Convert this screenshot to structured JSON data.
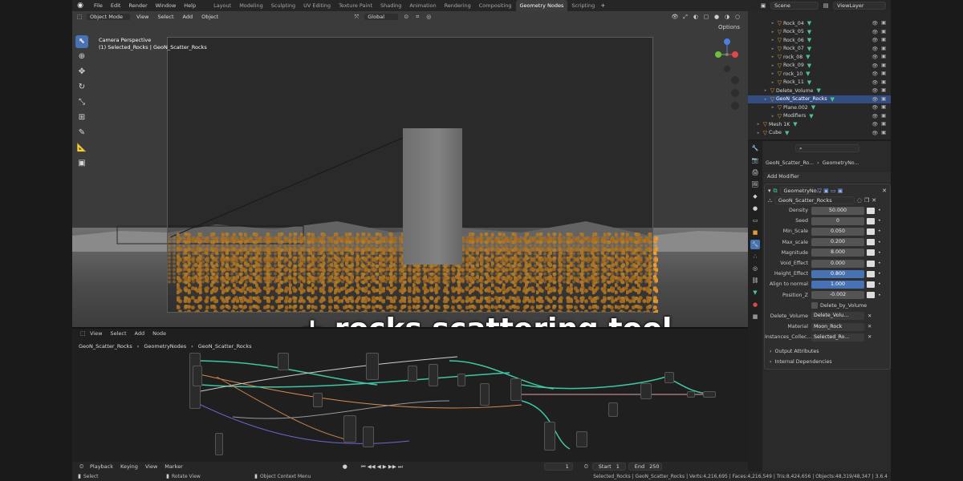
{
  "menu": [
    "File",
    "Edit",
    "Render",
    "Window",
    "Help"
  ],
  "workspaces": [
    "Layout",
    "Modeling",
    "Sculpting",
    "UV Editing",
    "Texture Paint",
    "Shading",
    "Animation",
    "Rendering",
    "Compositing",
    "Geometry Nodes",
    "Scripting"
  ],
  "active_workspace": "Geometry Nodes",
  "scene": "Scene",
  "view_layer": "ViewLayer",
  "viewport": {
    "mode": "Object Mode",
    "menus": [
      "View",
      "Select",
      "Add",
      "Object"
    ],
    "orientation": "Global",
    "options_label": "Options",
    "info_line1": "Camera Perspective",
    "info_line2": "(1) Selected_Rocks | GeoN_Scatter_Rocks"
  },
  "caption": "+ rocks scattering tool",
  "node_editor": {
    "menus": [
      "View",
      "Select",
      "Add",
      "Node"
    ],
    "breadcrumb": [
      "GeoN_Scatter_Rocks",
      "GeometryNodes",
      "GeoN_Scatter_Rocks"
    ]
  },
  "outliner": [
    {
      "name": "Rock_04",
      "indent": 3,
      "sel": false
    },
    {
      "name": "Rock_05",
      "indent": 3,
      "sel": false
    },
    {
      "name": "Rock_06",
      "indent": 3,
      "sel": false
    },
    {
      "name": "Rock_07",
      "indent": 3,
      "sel": false
    },
    {
      "name": "rock_08",
      "indent": 3,
      "sel": false
    },
    {
      "name": "Rock_09",
      "indent": 3,
      "sel": false
    },
    {
      "name": "rock_10",
      "indent": 3,
      "sel": false
    },
    {
      "name": "Rock_11",
      "indent": 3,
      "sel": false
    },
    {
      "name": "Delete_Volume",
      "indent": 2,
      "sel": false
    },
    {
      "name": "GeoN_Scatter_Rocks",
      "indent": 2,
      "sel": true
    },
    {
      "name": "Plane.002",
      "indent": 3,
      "sel": false
    },
    {
      "name": "Modifiers",
      "indent": 3,
      "sel": false
    },
    {
      "name": "Mesh 1K",
      "indent": 1,
      "sel": false
    },
    {
      "name": "Cube",
      "indent": 1,
      "sel": false
    }
  ],
  "properties": {
    "object_name": "GeoN_Scatter_Ro...",
    "breadcrumb_tail": "GeometryNo...",
    "add_modifier": "Add Modifier",
    "modifier_name": "GeometryNo...",
    "node_group": "GeoN_Scatter_Rocks",
    "params": [
      {
        "label": "Density",
        "value": "50.000",
        "style": "normal"
      },
      {
        "label": "Seed",
        "value": "0",
        "style": "normal"
      },
      {
        "label": "Min_Scale",
        "value": "0.050",
        "style": "normal"
      },
      {
        "label": "Max_scale",
        "value": "0.200",
        "style": "normal"
      },
      {
        "label": "Magnitude",
        "value": "8.000",
        "style": "normal"
      },
      {
        "label": "Void_Effect",
        "value": "0.000",
        "style": "normal"
      },
      {
        "label": "Height_Effect",
        "value": "0.800",
        "style": "blue"
      },
      {
        "label": "Align to normal",
        "value": "1.000",
        "style": "blue"
      },
      {
        "label": "Position_Z",
        "value": "-0.002",
        "style": "normal"
      }
    ],
    "checkbox_label": "Delete_by_Volume",
    "refs": [
      {
        "label": "Delete_Volume",
        "value": "Delete_Volu..."
      },
      {
        "label": "Material",
        "value": "Moon_Rock"
      },
      {
        "label": "Instances_Collec...",
        "value": "Selected_Ro..."
      }
    ],
    "sections": [
      "Output Attributes",
      "Internal Dependencies"
    ]
  },
  "timeline": {
    "items": [
      "Playback",
      "Keying",
      "View",
      "Marker"
    ],
    "frame": "1",
    "start_label": "Start",
    "start": "1",
    "end_label": "End",
    "end": "250"
  },
  "status": {
    "left": [
      "Select",
      "Rotate View",
      "Object Context Menu"
    ],
    "right": "Selected_Rocks | GeoN_Scatter_Rocks | Verts:4,216,695 | Faces:4,216,549 | Tris:8,424,656 | Objects:48,319/48,347 | 3.6.4"
  }
}
